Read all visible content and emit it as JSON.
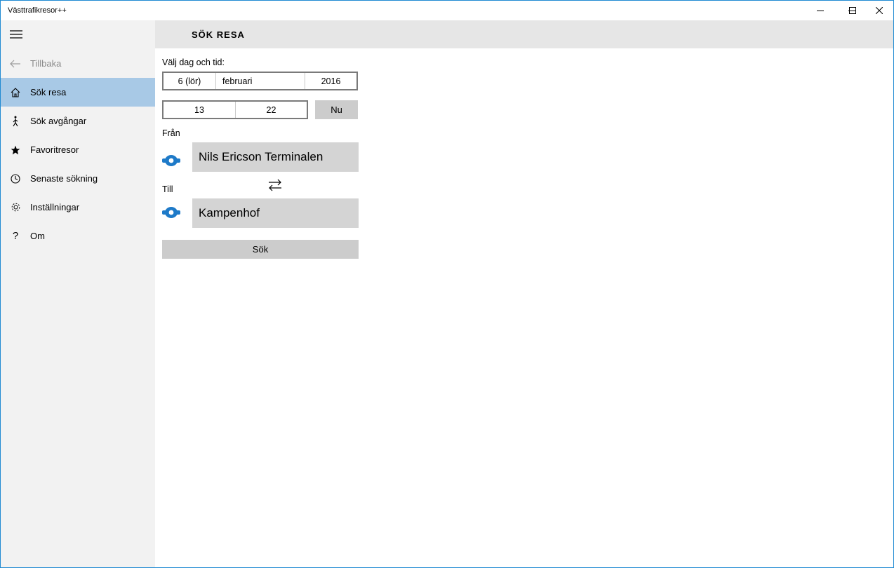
{
  "window": {
    "title": "Västtrafikresor++"
  },
  "sidebar": {
    "back_label": "Tillbaka",
    "items": [
      {
        "label": "Sök resa",
        "icon": "home-icon"
      },
      {
        "label": "Sök avgångar",
        "icon": "walker-icon"
      },
      {
        "label": "Favoritresor",
        "icon": "star-icon"
      },
      {
        "label": "Senaste sökning",
        "icon": "clock-icon"
      },
      {
        "label": "Inställningar",
        "icon": "gear-icon"
      },
      {
        "label": "Om",
        "icon": "question-icon"
      }
    ],
    "active_index": 0
  },
  "header": {
    "title": "SÖK RESA"
  },
  "search": {
    "date_time_label": "Välj dag och tid:",
    "date": {
      "day": "6 (lör)",
      "month": "februari",
      "year": "2016"
    },
    "time": {
      "hour": "13",
      "minute": "22"
    },
    "now_label": "Nu",
    "from_label": "Från",
    "from_value": "Nils Ericson Terminalen",
    "to_label": "Till",
    "to_value": "Kampenhof",
    "search_label": "Sök"
  },
  "colors": {
    "accent": "#a8c9e6",
    "stop_icon": "#1e7ac8",
    "window_border": "#1f8ad2"
  }
}
